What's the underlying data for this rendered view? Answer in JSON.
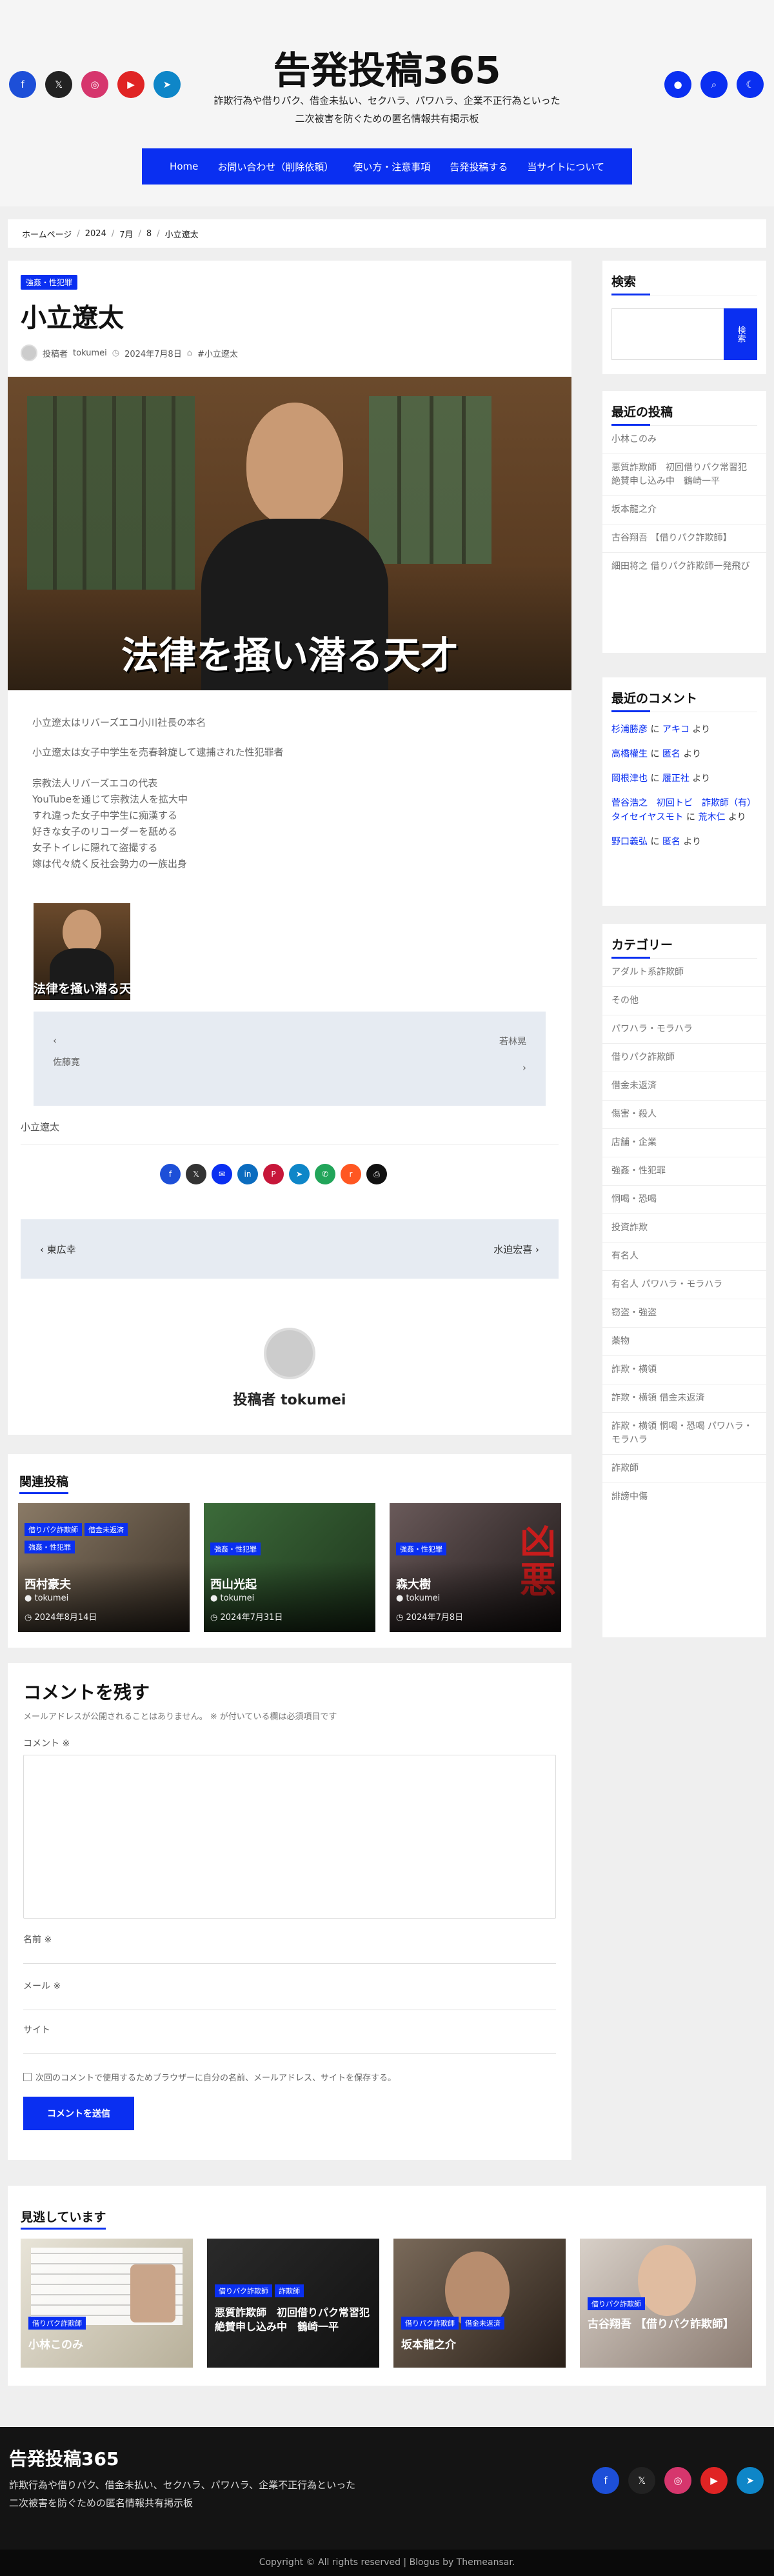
{
  "site": {
    "title": "告発投稿365",
    "description_line1": "詐欺行為や借りパク、借金未払い、セクハラ、パワハラ、企業不正行為といった",
    "description_line2": "二次被害を防ぐための匿名情報共有掲示板"
  },
  "nav": [
    "Home",
    "お問い合わせ（削除依頼）",
    "使い方・注意事項",
    "告発投稿する",
    "当サイトについて"
  ],
  "breadcrumb": [
    "ホームページ",
    "2024",
    "7月",
    "8",
    "小立遼太"
  ],
  "post": {
    "category": "強姦・性犯罪",
    "title": "小立遼太",
    "author_prefix": "投稿者",
    "author": "tokumei",
    "date": "2024年7月8日",
    "tag": "#小立遼太",
    "image_caption": "法律を掻い潜る天才",
    "thumb_caption": "法律を掻い潜る天",
    "paragraphs": [
      "小立遼太はリバーズエコ小川社長の本名",
      "小立遼太は女子中学生を売春斡旋して逮捕された性犯罪者"
    ],
    "lines": [
      "宗教法人リバーズエコの代表",
      "YouTubeを通じて宗教法人を拡大中",
      "すれ違った女子中学生に痴漢する",
      "好きな女子のリコーダーを舐める",
      "女子トイレに隠れて盗撮する",
      "嫁は代々続く反社会勢力の一族出身"
    ],
    "nav_prev_name": "佐藤寛",
    "nav_next_name": "若林晃",
    "tag_link": "小立遼太",
    "prev_post": "東広幸",
    "next_post": "水迫宏喜"
  },
  "author_box": {
    "label": "投稿者 tokumei"
  },
  "related": {
    "title": "関連投稿",
    "items": [
      {
        "badges": [
          "借りパク詐欺師",
          "借金未返済",
          "強姦・性犯罪"
        ],
        "title": "西村豪夫",
        "author": "tokumei",
        "date": "2024年8月14日"
      },
      {
        "badges": [
          "強姦・性犯罪"
        ],
        "title": "西山光起",
        "author": "tokumei",
        "date": "2024年7月31日"
      },
      {
        "badges": [
          "強姦・性犯罪"
        ],
        "title": "森大樹",
        "author": "tokumei",
        "date": "2024年7月8日"
      }
    ]
  },
  "comment_form": {
    "title": "コメントを残す",
    "note": "メールアドレスが公開されることはありません。 ※ が付いている欄は必須項目です",
    "comment_label": "コメント ※",
    "name_label": "名前 ※",
    "email_label": "メール ※",
    "site_label": "サイト",
    "save_label": "次回のコメントで使用するためブラウザーに自分の名前、メールアドレス、サイトを保存する。",
    "submit": "コメントを送信"
  },
  "sidebar": {
    "search_title": "検索",
    "search_button": "検索",
    "recent_title": "最近の投稿",
    "recent": [
      "小林このみ",
      "悪質詐欺師　初回借りパク常習犯　絶賛申し込み中　鶴崎一平",
      "坂本龍之介",
      "古谷翔吾 【借りパク詐欺師】",
      "細田将之 借りパク詐欺師一発飛び"
    ],
    "comments_title": "最近のコメント",
    "comments": [
      {
        "who": "杉浦勝彦",
        "on": "に",
        "what": "アキコ",
        "tail": "より"
      },
      {
        "who": "高橋權生",
        "on": "に",
        "what": "匿名",
        "tail": "より"
      },
      {
        "who": "岡根津也",
        "on": "に",
        "what": "履正社",
        "tail": "より"
      },
      {
        "who": "菅谷浩之　初回トビ　詐欺師（有）タイセイヤスモト",
        "on": "に",
        "what": "荒木仁",
        "tail": "より"
      },
      {
        "who": "野口義弘",
        "on": "に",
        "what": "匿名",
        "tail": "より"
      }
    ],
    "categories_title": "カテゴリー",
    "categories": [
      "アダルト系詐欺師",
      "その他",
      "パワハラ・モラハラ",
      "借りパク詐欺師",
      "借金未返済",
      "傷害・殺人",
      "店舗・企業",
      "強姦・性犯罪",
      "恫喝・恐喝",
      "投資詐欺",
      "有名人",
      "有名人 パワハラ・モラハラ",
      "窃盗・強盗",
      "薬物",
      "詐欺・横領",
      "詐欺・横領 借金未返済",
      "詐欺・横領 恫喝・恐喝 パワハラ・モラハラ",
      "詐欺師",
      "誹謗中傷"
    ]
  },
  "see_more": {
    "title": "見逃しています",
    "items": [
      {
        "badges": [
          "借りパク詐欺師"
        ],
        "title": "小林このみ"
      },
      {
        "badges": [
          "借りパク詐欺師",
          "詐欺師"
        ],
        "title": "悪質詐欺師　初回借りパク常習犯　絶賛申し込み中　鶴崎一平"
      },
      {
        "badges": [
          "借りパク詐欺師",
          "借金未返済"
        ],
        "title": "坂本龍之介"
      },
      {
        "badges": [
          "借りパク詐欺師"
        ],
        "title": "古谷翔吾 【借りパク詐欺師】"
      }
    ]
  },
  "footer": {
    "title": "告発投稿365",
    "desc1": "詐欺行為や借りパク、借金未払い、セクハラ、パワハラ、企業不正行為といった",
    "desc2": "二次被害を防ぐための匿名情報共有掲示板",
    "copyright": "Copyright © All rights reserved | Blogus by Themeansar."
  },
  "colors": {
    "accent": "#0a2ff1",
    "facebook": "#1d4fd8",
    "x": "#222222",
    "instagram": "#d6366d",
    "youtube": "#e02424",
    "telegram": "#0e86c8"
  }
}
